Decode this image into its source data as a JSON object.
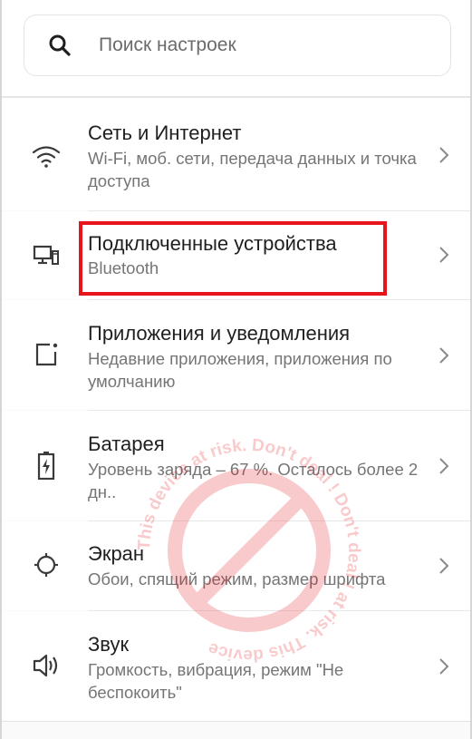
{
  "search": {
    "placeholder": "Поиск настроек"
  },
  "settings": {
    "items": [
      {
        "title": "Сеть и Интернет",
        "subtitle": "Wi-Fi, моб. сети, передача данных и точка доступа",
        "icon": "wifi-icon"
      },
      {
        "title": "Подключенные устройства",
        "subtitle": "Bluetooth",
        "icon": "devices-icon"
      },
      {
        "title": "Приложения и уведомления",
        "subtitle": "Недавние приложения, приложения по умолчанию",
        "icon": "apps-icon"
      },
      {
        "title": "Батарея",
        "subtitle": "Уровень заряда – 67 %. Осталось более 2 дн..",
        "icon": "battery-icon"
      },
      {
        "title": "Экран",
        "subtitle": "Обои, спящий режим, размер шрифта",
        "icon": "display-icon"
      },
      {
        "title": "Звук",
        "subtitle": "Громкость, вибрация, режим \"Не беспокоить\"",
        "icon": "sound-icon"
      }
    ]
  },
  "watermark": {
    "text": "This device at risk. Don't deal ! Don't deal ! at risk. This device"
  },
  "colors": {
    "highlight": "#e8141c",
    "watermark": "#e8141c"
  }
}
